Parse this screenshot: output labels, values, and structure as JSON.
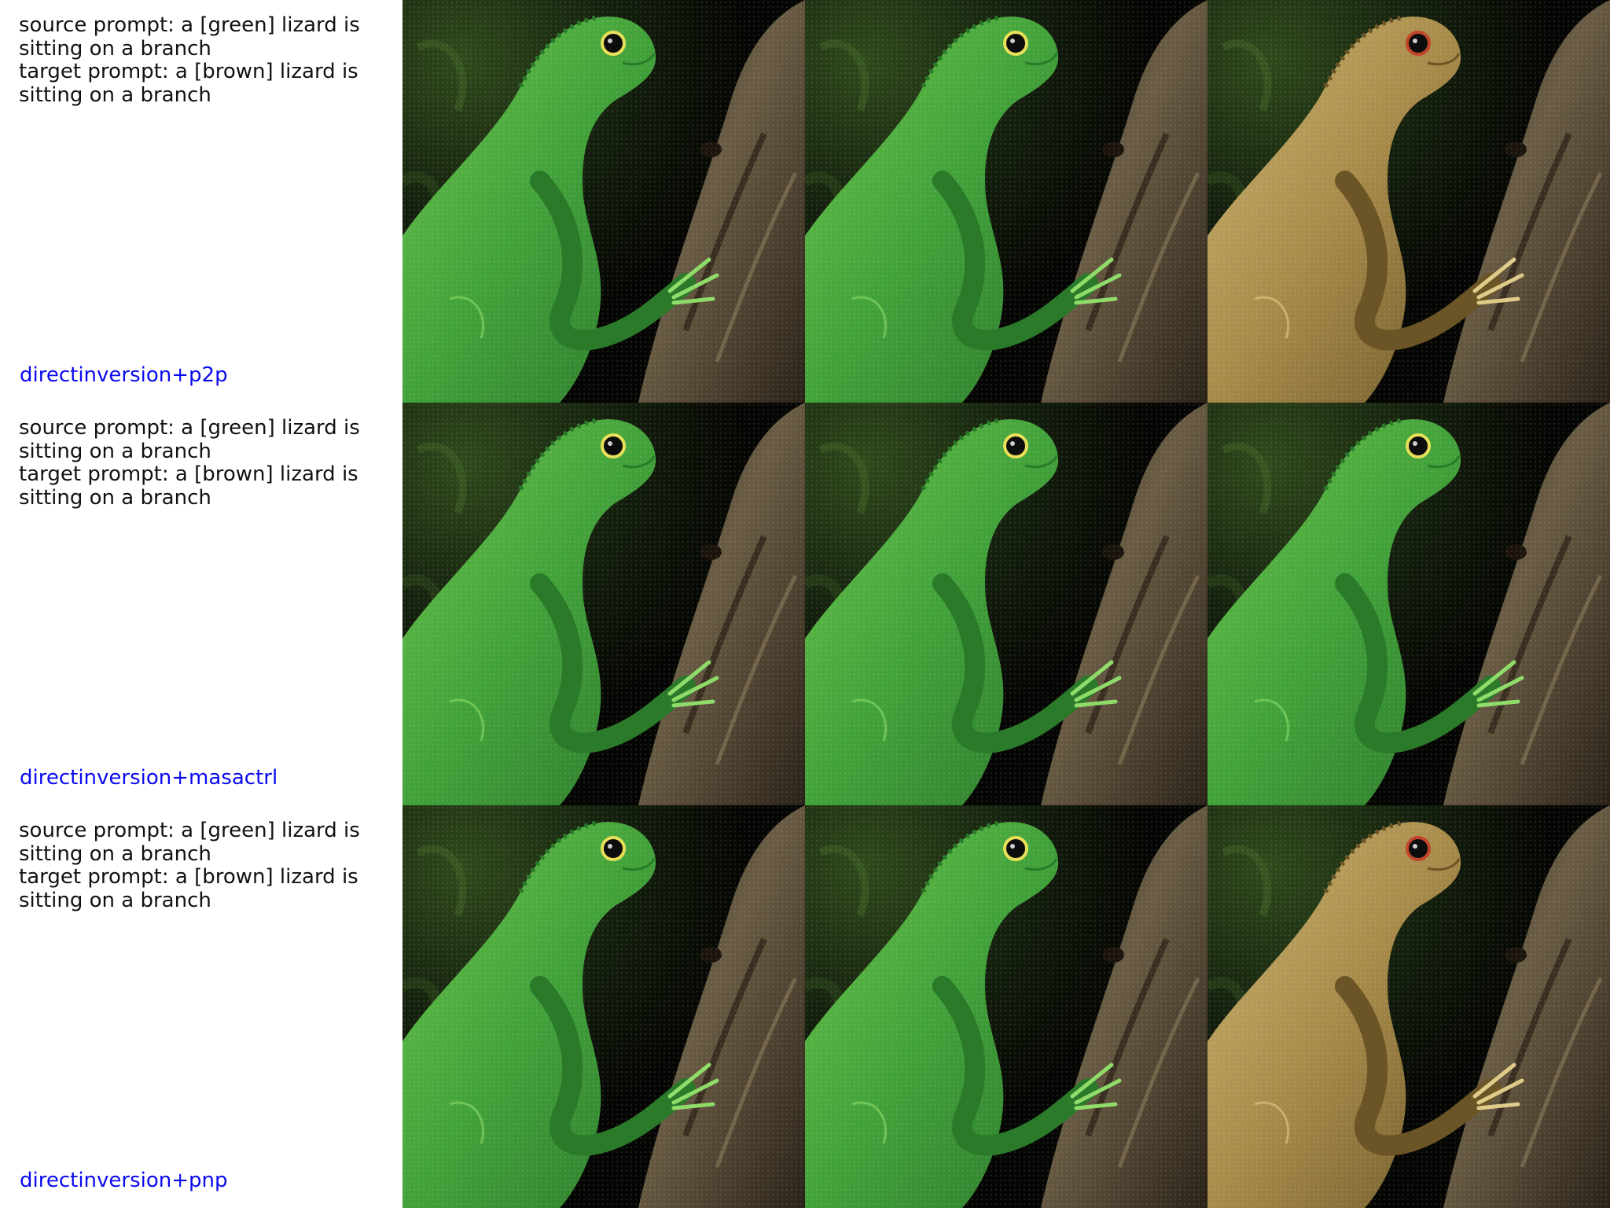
{
  "rows": [
    {
      "source_prompt": "source prompt: a [green] lizard is sitting on a branch",
      "target_prompt": "target prompt: a [brown] lizard is sitting on a branch",
      "method": "directinversion+p2p",
      "images": [
        "green-lizard-on-branch",
        "green-lizard-on-branch",
        "brown-lizard-on-branch"
      ]
    },
    {
      "source_prompt": "source prompt: a [green] lizard is sitting on a branch",
      "target_prompt": "target prompt: a [brown] lizard is sitting on a branch",
      "method": "directinversion+masactrl",
      "images": [
        "green-lizard-on-branch",
        "green-lizard-on-branch",
        "green-lizard-on-branch"
      ]
    },
    {
      "source_prompt": "source prompt: a [green] lizard is sitting on a branch",
      "target_prompt": "target prompt: a [brown] lizard is sitting on a branch",
      "method": "directinversion+pnp",
      "images": [
        "green-lizard-on-branch",
        "green-lizard-on-branch",
        "brown-lizard-on-branch"
      ]
    }
  ],
  "colors": {
    "prompt_text": "#111111",
    "method_label": "#0a0af0",
    "green_lizard": "#4fae3a",
    "brown_lizard": "#b59a55",
    "branch": "#4a3f30",
    "background": "#0b0d06"
  }
}
